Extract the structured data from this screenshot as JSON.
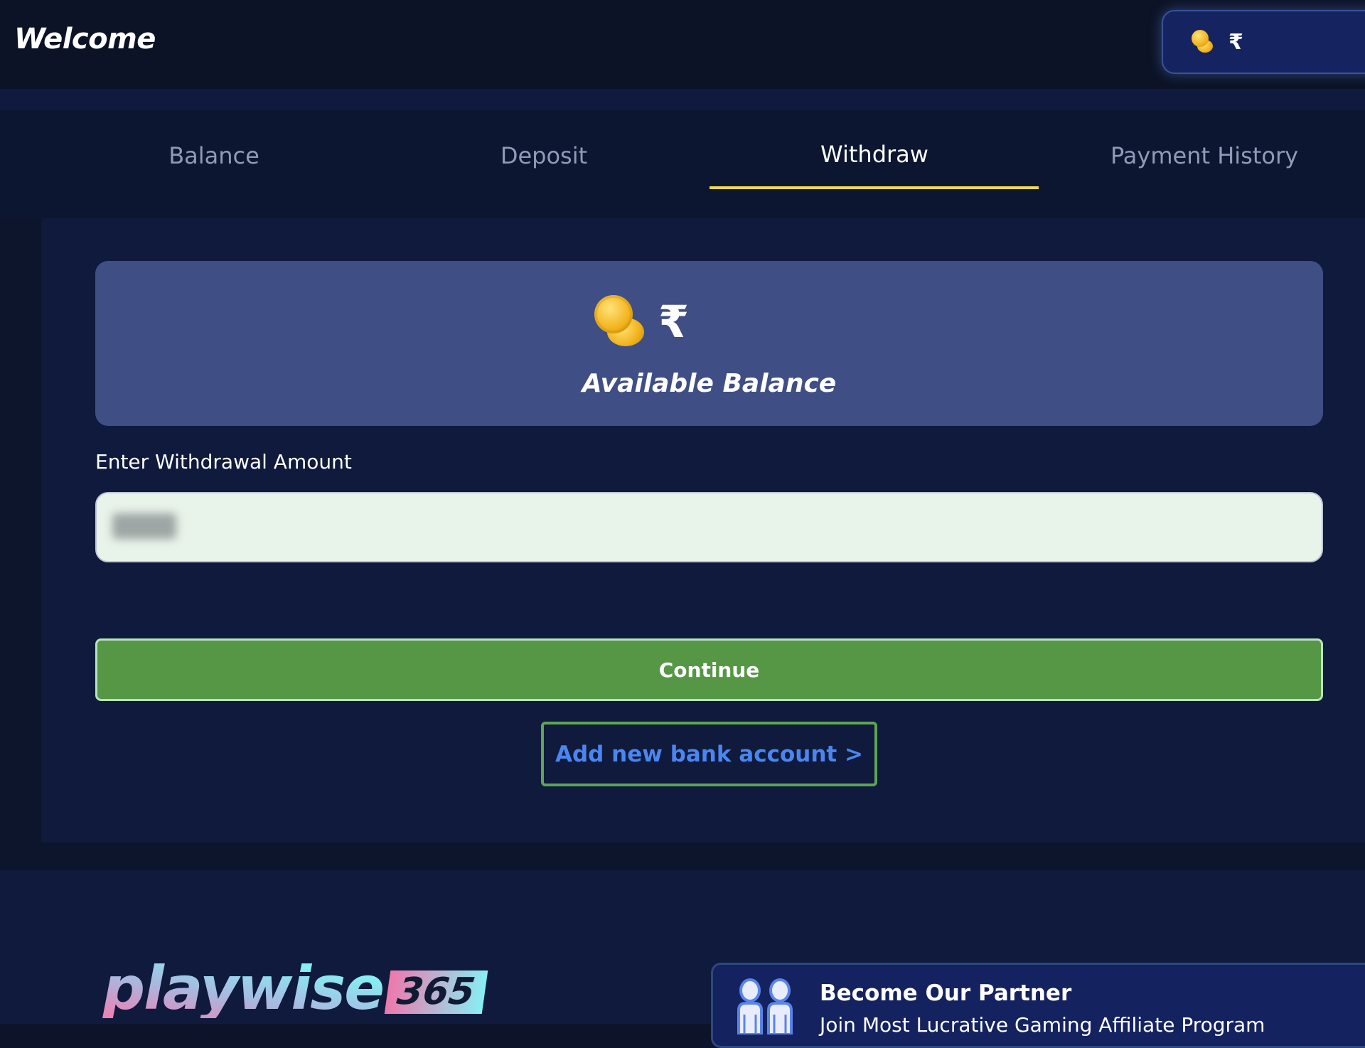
{
  "header": {
    "title": "Welcome",
    "balance_pill": {
      "coin_icon": "coins-icon",
      "currency_symbol": "₹",
      "amount": ""
    }
  },
  "tabs": [
    {
      "label": "Balance",
      "active": false
    },
    {
      "label": "Deposit",
      "active": false
    },
    {
      "label": "Withdraw",
      "active": true
    },
    {
      "label": "Payment History",
      "active": false
    }
  ],
  "balance_card": {
    "coin_icon": "coins-icon",
    "currency_symbol": "₹",
    "amount": "",
    "title": "Available Balance"
  },
  "withdraw_form": {
    "label": "Enter Withdrawal Amount",
    "input_value": "",
    "input_value_note": "blurred",
    "continue_label": "Continue",
    "add_bank_label": "Add new bank account >"
  },
  "footer": {
    "logo_word": "playwise",
    "logo_badge": "365",
    "partner": {
      "icon": "partners-icon",
      "title": "Become Our Partner",
      "subtitle": "Join Most Lucrative Gaming Affiliate Program"
    }
  },
  "colors": {
    "accent_underline": "#efd84a",
    "continue_green": "#559744",
    "link_blue": "#4b86f0",
    "card_blue": "#3f4f85",
    "background": "#0f1a3c"
  }
}
